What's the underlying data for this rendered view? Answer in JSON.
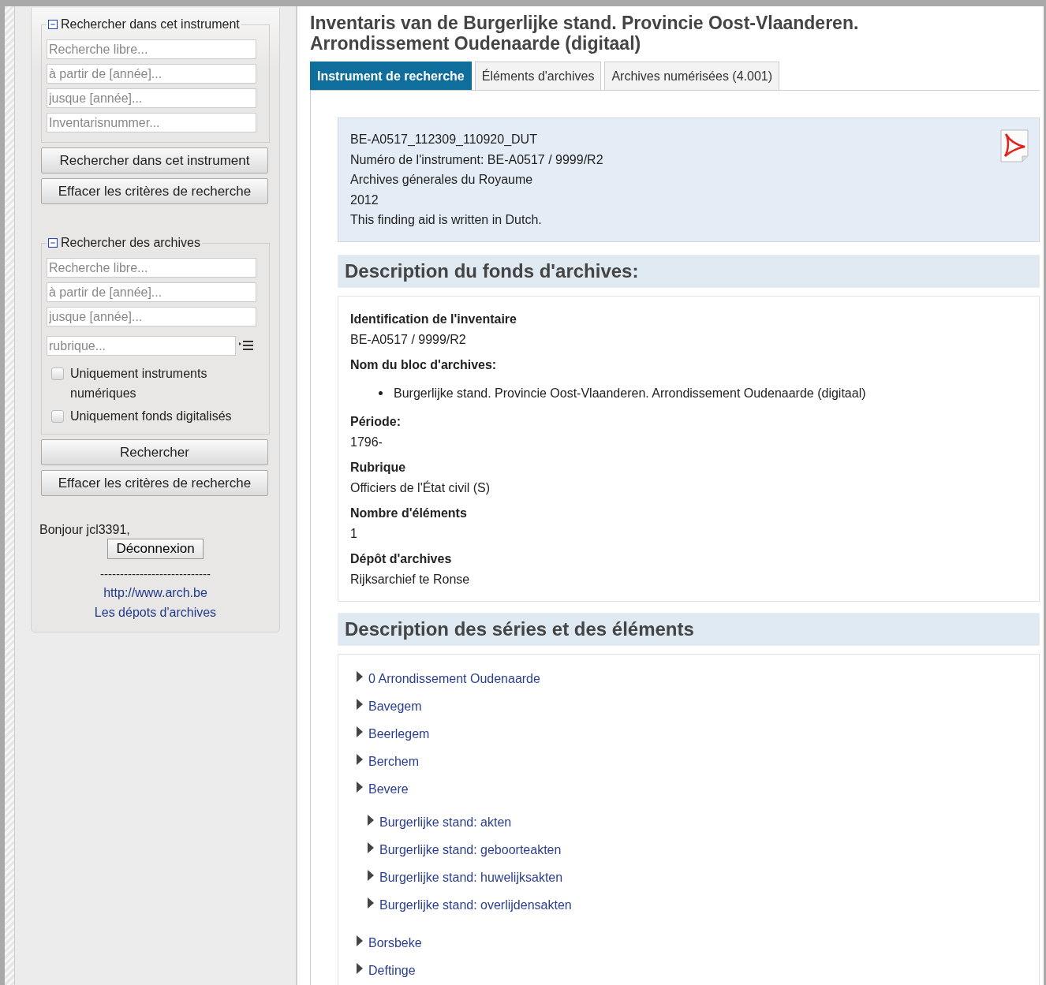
{
  "sidebar": {
    "instrument_search": {
      "legend": "Rechercher dans cet instrument",
      "fields": [
        {
          "placeholder": "Recherche libre..."
        },
        {
          "placeholder": "à partir de [année]..."
        },
        {
          "placeholder": "jusque [année]..."
        },
        {
          "placeholder": "Inventarisnummer..."
        }
      ],
      "buttons": [
        "Rechercher dans cet instrument",
        "Effacer les critères de recherche"
      ]
    },
    "archive_search": {
      "legend": "Rechercher des archives",
      "fields": [
        {
          "placeholder": "Recherche libre...",
          "kind": "text"
        },
        {
          "placeholder": "à partir de [année]...",
          "kind": "text"
        },
        {
          "placeholder": "jusque [année]...",
          "kind": "text"
        },
        {
          "placeholder": "rubrique...",
          "kind": "picker"
        }
      ],
      "checkboxes": [
        {
          "label": "Uniquement instruments numériques",
          "checked": false
        },
        {
          "label": "Uniquement fonds digitalisés",
          "checked": false
        }
      ],
      "buttons": [
        "Rechercher",
        "Effacer les critères de recherche"
      ]
    },
    "greeting": "Bonjour jcl3391,",
    "logout_button": "Déconnexion",
    "separator": "----------------------------",
    "links": [
      "http://www.arch.be",
      "Les dépots d'archives"
    ]
  },
  "main": {
    "title": "Inventaris van de Burgerlijke stand. Provincie Oost-Vlaanderen. Arrondissement Oudenaarde (digitaal)",
    "tabs": [
      {
        "label": "Instrument de recherche",
        "selected": true
      },
      {
        "label": "Éléments d'archives",
        "selected": false
      },
      {
        "label": "Archives numérisées (4.001)",
        "selected": false
      }
    ],
    "info_lines": [
      "BE-A0517_112309_110920_DUT",
      "Numéro de l'instrument: BE-A0517 / 9999/R2",
      "Archives génerales du Royaume",
      "2012",
      "This finding aid is written in Dutch."
    ],
    "fonds_heading": "Description du fonds d'archives:",
    "fonds_fields": [
      {
        "label": "Identification de l'inventaire",
        "kind": "text",
        "value": "BE-A0517 / 9999/R2"
      },
      {
        "label": "Nom du bloc d'archives:",
        "kind": "bullet",
        "value": "Burgerlijke stand. Provincie Oost-Vlaanderen. Arrondissement Oudenaarde (digitaal)"
      },
      {
        "label": "Période:",
        "kind": "text",
        "value": "1796-"
      },
      {
        "label": "Rubrique",
        "kind": "text",
        "value": "Officiers de l'État civil (S)"
      },
      {
        "label": "Nombre d'éléments",
        "kind": "text",
        "value": "1"
      },
      {
        "label": "Dépôt d'archives",
        "kind": "text",
        "value": "Rijksarchief te Ronse"
      }
    ],
    "series_heading": "Description des séries et des éléments",
    "tree": [
      {
        "label": "0 Arrondissement Oudenaarde"
      },
      {
        "label": "Bavegem"
      },
      {
        "label": "Beerlegem"
      },
      {
        "label": "Berchem"
      },
      {
        "label": "Bevere",
        "children": [
          {
            "label": "Burgerlijke stand: akten"
          },
          {
            "label": "Burgerlijke stand: geboorteakten"
          },
          {
            "label": "Burgerlijke stand: huwelijksakten"
          },
          {
            "label": "Burgerlijke stand: overlijdensakten"
          }
        ]
      },
      {
        "label": "Borsbeke"
      },
      {
        "label": "Deftinge"
      }
    ]
  }
}
